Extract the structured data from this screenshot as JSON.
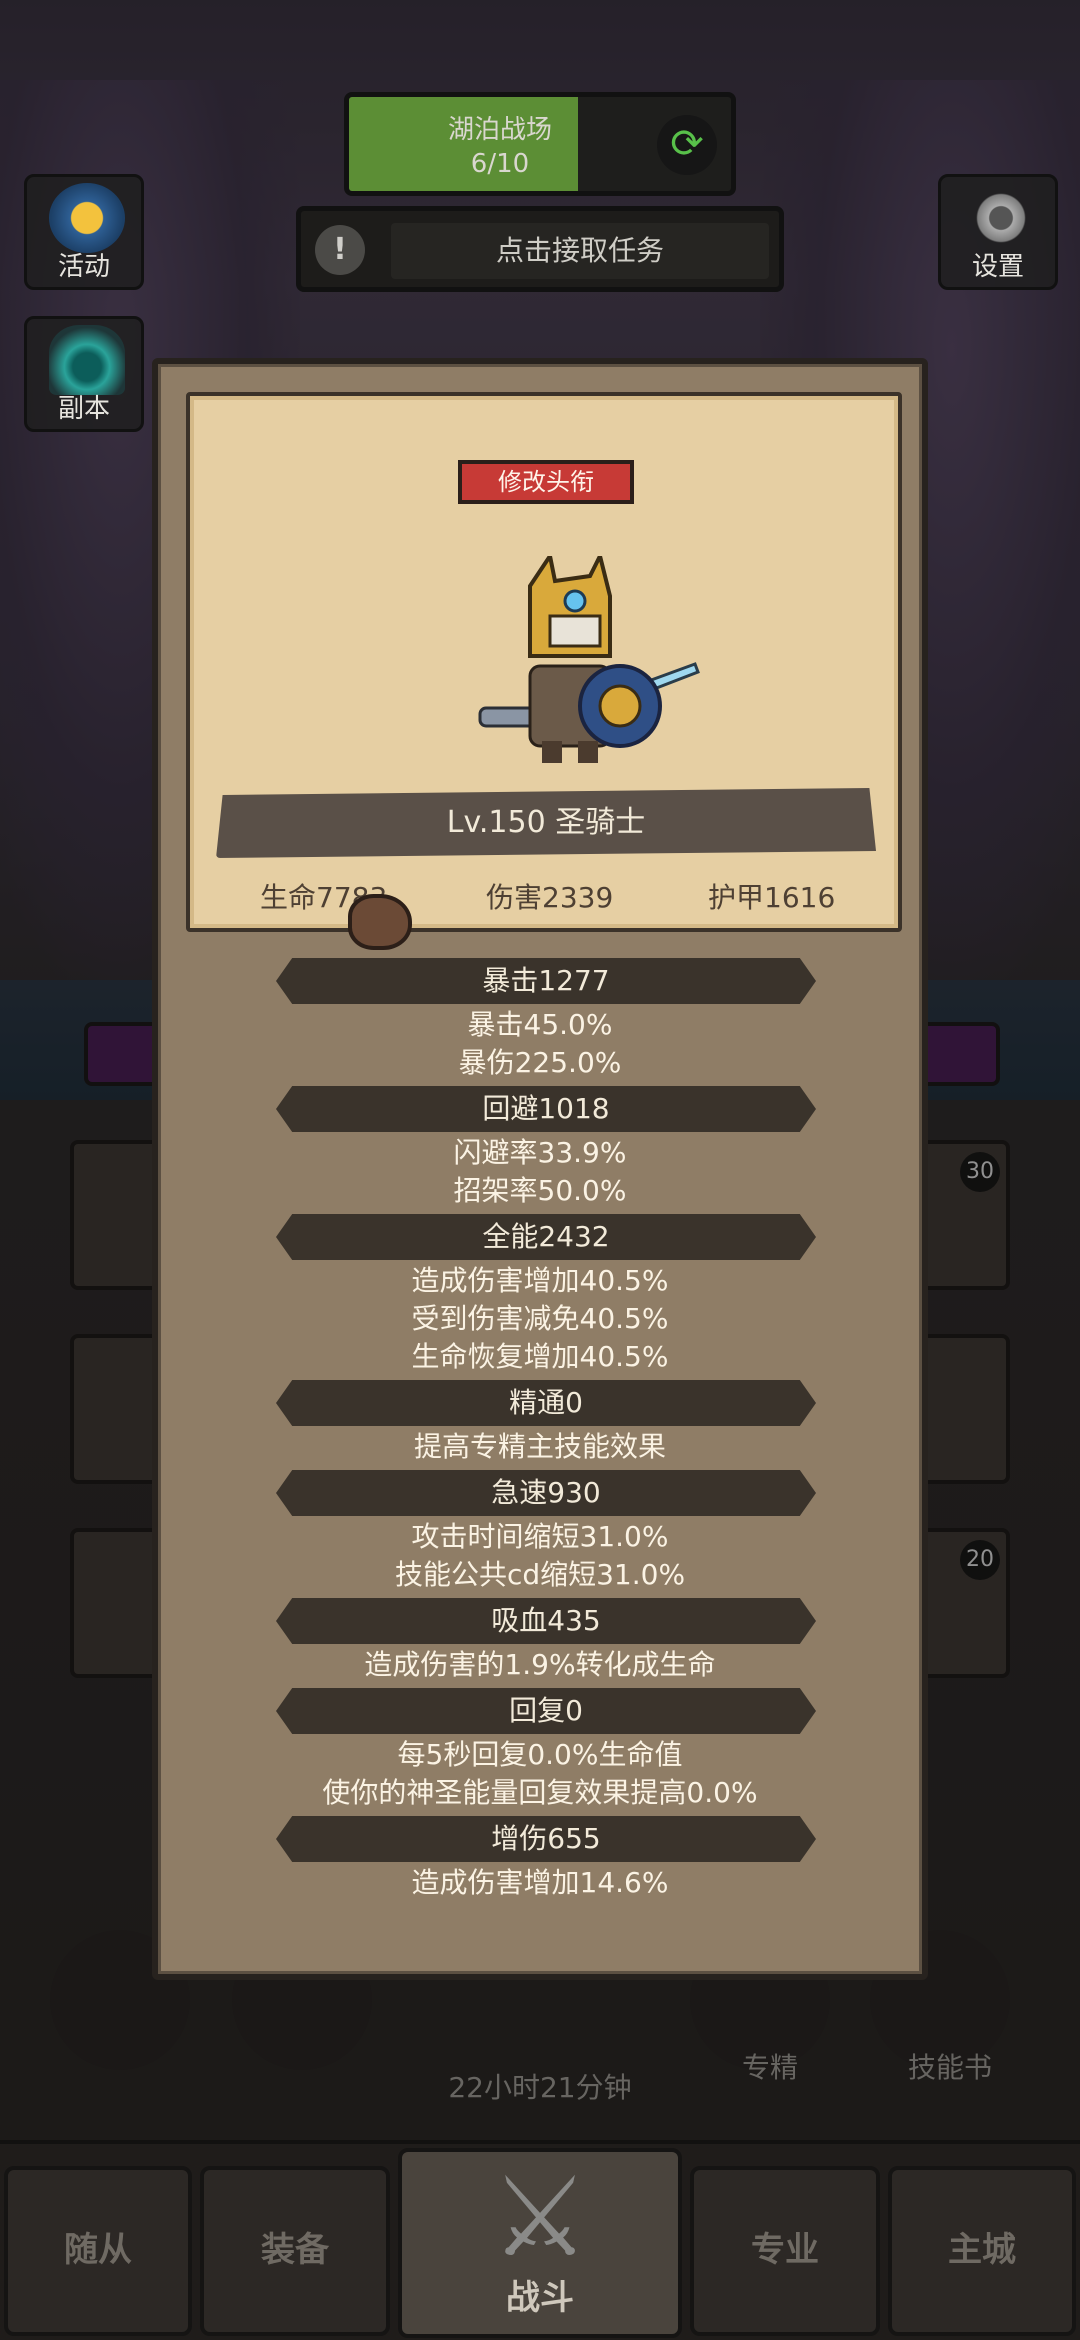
{
  "hud": {
    "battlefield_name": "湖泊战场",
    "battlefield_progress_text": "6/10",
    "battlefield_progress": 0.6,
    "task_prompt": "点击接取任务"
  },
  "side_buttons": {
    "activity": "活动",
    "dungeon": "副本",
    "settings": "设置"
  },
  "grid_badges": [
    "30",
    "20"
  ],
  "bottom_icons": {
    "timer": "22小时21分钟",
    "specialization": "专精",
    "skill_book": "技能书"
  },
  "bottom_nav": {
    "followers": "随从",
    "equipment": "装备",
    "battle": "战斗",
    "profession": "专业",
    "main_city": "主城"
  },
  "hero_card": {
    "edit_title_button": "修改头衔",
    "name_level": "Lv.150 圣骑士",
    "hp": "生命7783",
    "damage": "伤害2339",
    "armor": "护甲1616"
  },
  "stats": [
    {
      "header": "暴击1277",
      "lines": [
        "暴击45.0%",
        "暴伤225.0%"
      ]
    },
    {
      "header": "回避1018",
      "lines": [
        "闪避率33.9%",
        "招架率50.0%"
      ]
    },
    {
      "header": "全能2432",
      "lines": [
        "造成伤害增加40.5%",
        "受到伤害减免40.5%",
        "生命恢复增加40.5%"
      ]
    },
    {
      "header": "精通0",
      "lines": [
        "提高专精主技能效果"
      ]
    },
    {
      "header": "急速930",
      "lines": [
        "攻击时间缩短31.0%",
        "技能公共cd缩短31.0%"
      ]
    },
    {
      "header": "吸血435",
      "lines": [
        "造成伤害的1.9%转化成生命"
      ]
    },
    {
      "header": "回复0",
      "lines": [
        "每5秒回复0.0%生命值",
        "使你的神圣能量回复效果提高0.0%"
      ]
    },
    {
      "header": "增伤655",
      "lines": [
        "造成伤害增加14.6%"
      ]
    }
  ]
}
